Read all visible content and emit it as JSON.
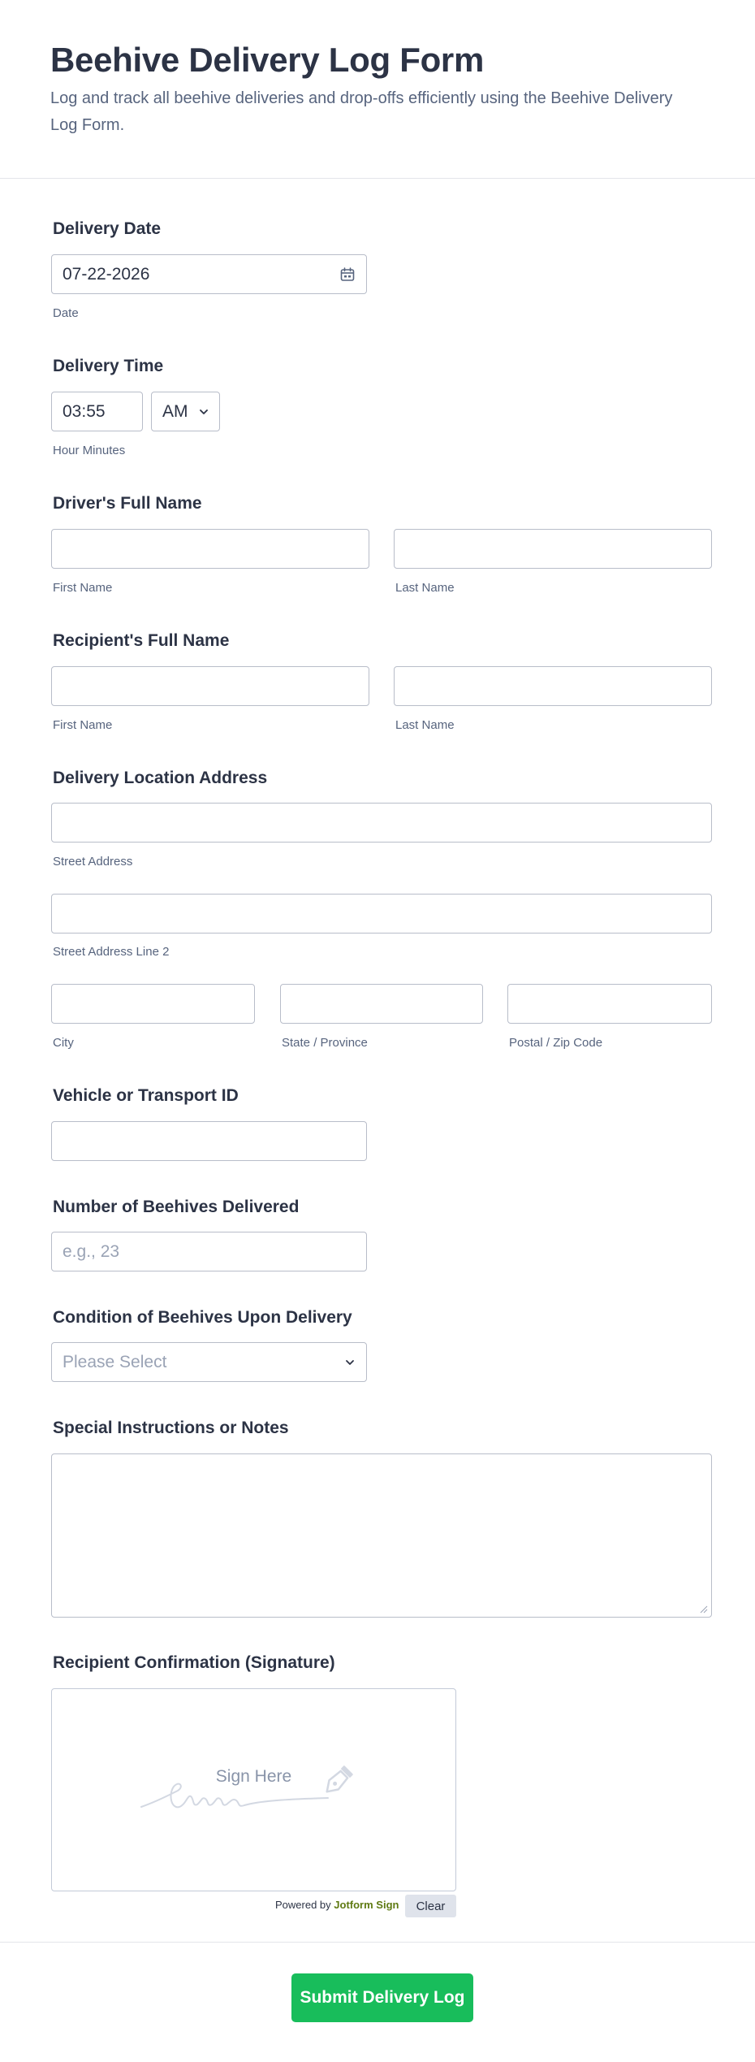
{
  "form": {
    "title": "Beehive Delivery Log Form",
    "description": "Log and track all beehive deliveries and drop-offs efficiently using the Beehive Delivery Log Form."
  },
  "delivery_date": {
    "label": "Delivery Date",
    "value": "07-22-2026",
    "sublabel": "Date",
    "icon": "calendar-icon"
  },
  "delivery_time": {
    "label": "Delivery Time",
    "value": "03:55",
    "ampm": "AM",
    "sublabel": "Hour Minutes"
  },
  "driver_name": {
    "label": "Driver's Full Name",
    "first_sub": "First Name",
    "last_sub": "Last Name"
  },
  "recipient_name": {
    "label": "Recipient's Full Name",
    "first_sub": "First Name",
    "last_sub": "Last Name"
  },
  "address": {
    "label": "Delivery Location Address",
    "street_sub": "Street Address",
    "street2_sub": "Street Address Line 2",
    "city_sub": "City",
    "state_sub": "State / Province",
    "zip_sub": "Postal / Zip Code"
  },
  "vehicle": {
    "label": "Vehicle or Transport ID"
  },
  "beehive_count": {
    "label": "Number of Beehives Delivered",
    "placeholder": "e.g., 23"
  },
  "condition": {
    "label": "Condition of Beehives Upon Delivery",
    "selected": "Please Select"
  },
  "notes": {
    "label": "Special Instructions or Notes"
  },
  "signature": {
    "label": "Recipient Confirmation (Signature)",
    "prompt": "Sign Here",
    "powered_prefix": "Powered by",
    "powered_brand": "Jotform Sign",
    "clear_label": "Clear"
  },
  "submit": {
    "label": "Submit Delivery Log",
    "color": "#18bd5b"
  }
}
